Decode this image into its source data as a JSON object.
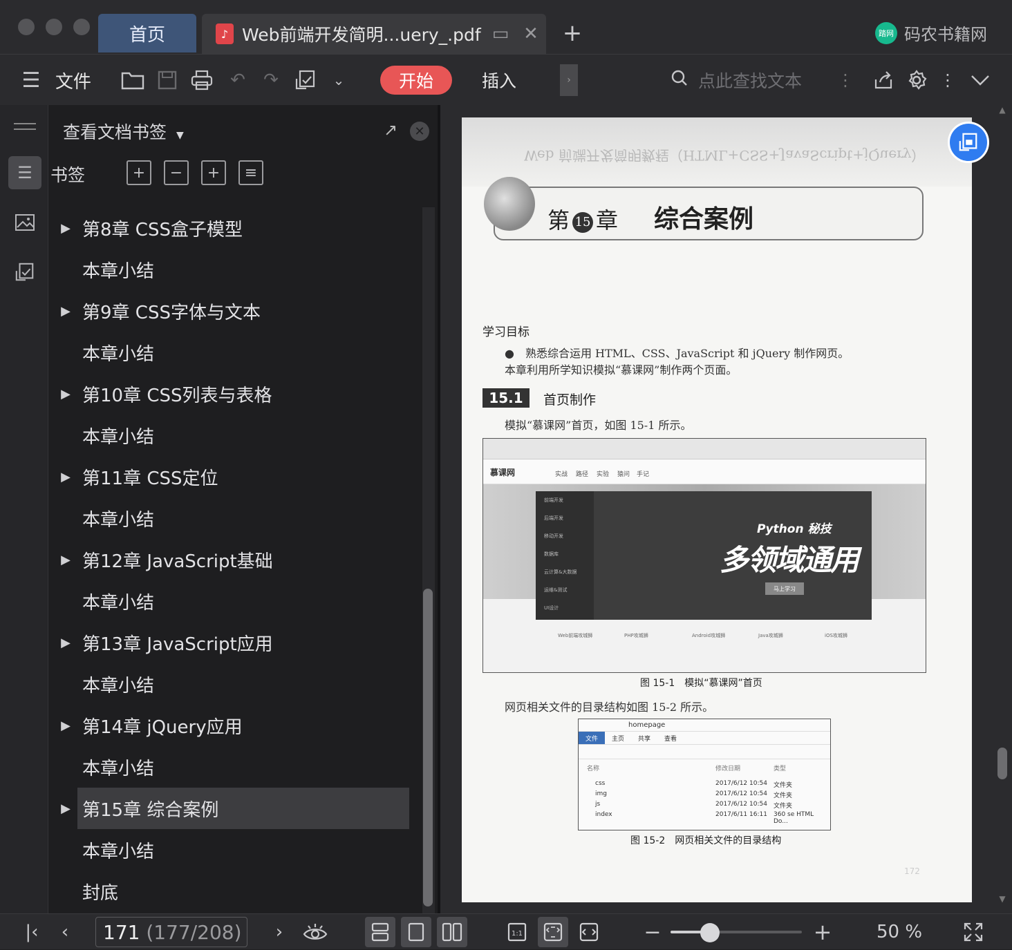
{
  "tabs": {
    "home_label": "首页",
    "doc_title": "Web前端开发简明...uery_.pdf",
    "new_tab": "+",
    "brand_name": "码农书籍网",
    "brand_logo_text": "踏网"
  },
  "toolbar": {
    "file_label": "文件",
    "start_label": "开始",
    "insert_label": "插入",
    "search_placeholder": "点此查找文本"
  },
  "sidebar": {
    "header": "查看文档书签",
    "bookmarks_label": "书签",
    "items": [
      {
        "label": "第8章 CSS盒子模型",
        "expandable": true
      },
      {
        "label": "本章小结",
        "expandable": false
      },
      {
        "label": "第9章 CSS字体与文本",
        "expandable": true
      },
      {
        "label": "本章小结",
        "expandable": false
      },
      {
        "label": "第10章 CSS列表与表格",
        "expandable": true
      },
      {
        "label": "本章小结",
        "expandable": false
      },
      {
        "label": "第11章 CSS定位",
        "expandable": true
      },
      {
        "label": "本章小结",
        "expandable": false
      },
      {
        "label": "第12章 JavaScript基础",
        "expandable": true
      },
      {
        "label": "本章小结",
        "expandable": false
      },
      {
        "label": "第13章 JavaScript应用",
        "expandable": true
      },
      {
        "label": "本章小结",
        "expandable": false
      },
      {
        "label": "第14章 jQuery应用",
        "expandable": true
      },
      {
        "label": "本章小结",
        "expandable": false
      },
      {
        "label": "第15章 综合案例",
        "expandable": true,
        "selected": true
      },
      {
        "label": "本章小结",
        "expandable": false
      },
      {
        "label": "封底",
        "expandable": false
      }
    ]
  },
  "document": {
    "bleed_text": "Web 前端开发简明教程（HTML+CSS+JavaScript+jQuery）",
    "chapter_prefix": "第",
    "chapter_number": "15",
    "chapter_suffix": "章",
    "chapter_title": "综合案例",
    "goals_heading": "学习目标",
    "goal_1": "●　熟悉综合运用 HTML、CSS、JavaScript 和 jQuery 制作网页。",
    "intro": "本章利用所学知识模拟“慕课网”制作两个页面。",
    "section_number": "15.1",
    "section_title": "首页制作",
    "section_text": "模拟“慕课网”首页，如图 15-1 所示。",
    "fig1": {
      "site_name": "慕课网",
      "nav": [
        "实战",
        "路径",
        "实验",
        "猿问",
        "手记"
      ],
      "menu": [
        "前端开发",
        "后端开发",
        "移动开发",
        "数据库",
        "云计算&大数据",
        "运维&测试",
        "UI设计"
      ],
      "banner_small": "Python 秘技",
      "banner_big": "多领域通用",
      "banner_button": "马上学习",
      "courses": [
        "Web前端攻城狮",
        "PHP攻城狮",
        "Android攻城狮",
        "Java攻城狮",
        "iOS攻城狮"
      ]
    },
    "fig1_caption": "图 15-1　模拟“慕课网”首页",
    "fig2_intro": "网页相关文件的目录结构如图 15-2 所示。",
    "fig2": {
      "folder": "homepage",
      "tabs": [
        "文件",
        "主页",
        "共享",
        "查看"
      ],
      "col_name": "名称",
      "col_date": "修改日期",
      "col_type": "类型",
      "rows": [
        {
          "name": "css",
          "date": "2017/6/12 10:54",
          "type": "文件夹"
        },
        {
          "name": "img",
          "date": "2017/6/12 10:54",
          "type": "文件夹"
        },
        {
          "name": "js",
          "date": "2017/6/12 10:54",
          "type": "文件夹"
        },
        {
          "name": "index",
          "date": "2017/6/11 16:11",
          "type": "360 se HTML Do..."
        }
      ]
    },
    "fig2_caption": "图 15-2　网页相关文件的目录结构",
    "page_footer_number": "172"
  },
  "status": {
    "page_current": "171",
    "page_total": "(177/208)",
    "zoom": "50 %",
    "zoom_fraction": 0.3
  },
  "colors": {
    "accent_start": "#e85656",
    "tab_home": "#3e5578",
    "float_button": "#2f7cf0"
  }
}
